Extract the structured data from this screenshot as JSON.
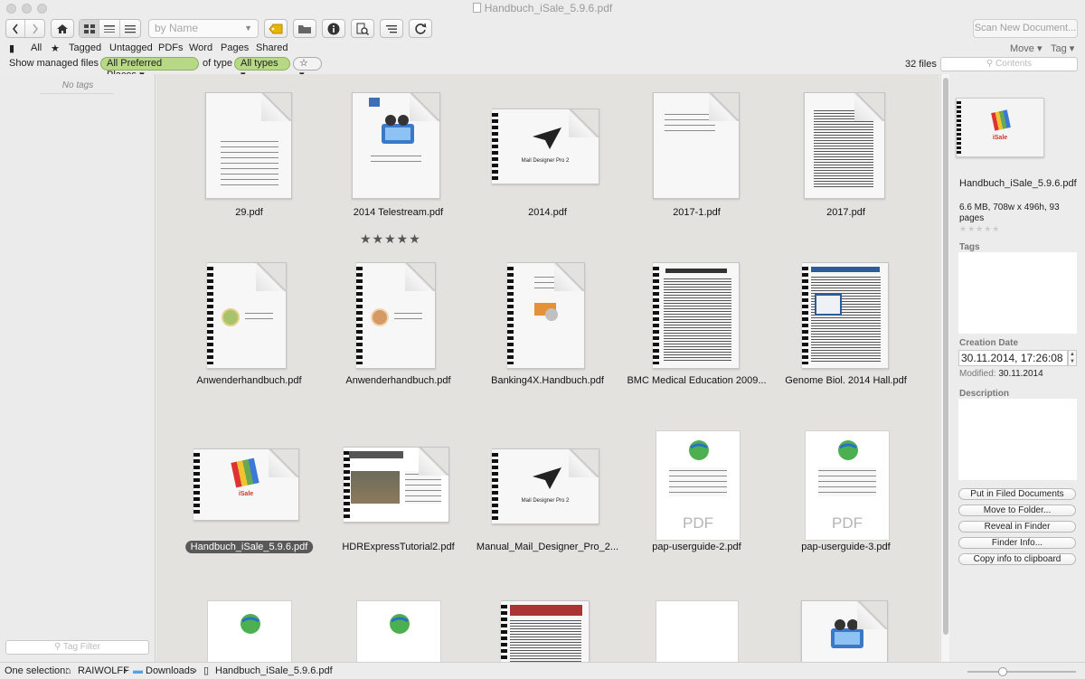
{
  "window": {
    "title": "Handbuch_iSale_5.9.6.pdf"
  },
  "toolbar": {
    "sort_placeholder": "by Name",
    "scan_button": "Scan New Document..."
  },
  "filters": {
    "all": "All",
    "tagged": "Tagged",
    "untagged": "Untagged",
    "pdfs": "PDFs",
    "word": "Word",
    "pages": "Pages",
    "shared": "Shared",
    "move": "Move ▾",
    "tag": "Tag ▾"
  },
  "options": {
    "show_label": "Show managed files in",
    "places": "All Preferred Places",
    "of_type": "of type",
    "types": "All types",
    "star_filter": "☆ ▾",
    "count": "32 files",
    "contents_placeholder": "Contents"
  },
  "sidebar": {
    "no_tags": "No tags",
    "tag_filter": "Tag Filter"
  },
  "files": [
    {
      "name": "29.pdf",
      "rating": ""
    },
    {
      "name": "2014 Telestream.pdf",
      "rating": "★★★★★"
    },
    {
      "name": "2014.pdf",
      "rating": ""
    },
    {
      "name": "2017-1.pdf",
      "rating": ""
    },
    {
      "name": "2017.pdf",
      "rating": ""
    },
    {
      "name": "Anwenderhandbuch.pdf",
      "rating": ""
    },
    {
      "name": "Anwenderhandbuch.pdf",
      "rating": ""
    },
    {
      "name": "Banking4X.Handbuch.pdf",
      "rating": ""
    },
    {
      "name": "BMC Medical Education 2009...",
      "rating": ""
    },
    {
      "name": "Genome Biol. 2014 Hall.pdf",
      "rating": ""
    },
    {
      "name": "Handbuch_iSale_5.9.6.pdf",
      "rating": "",
      "selected": true
    },
    {
      "name": "HDRExpressTutorial2.pdf",
      "rating": ""
    },
    {
      "name": "Manual_Mail_Designer_Pro_2...",
      "rating": ""
    },
    {
      "name": "pap-userguide-2.pdf",
      "rating": ""
    },
    {
      "name": "pap-userguide-3.pdf",
      "rating": ""
    }
  ],
  "thumb_text": {
    "mail_designer": "Mail Designer Pro 2",
    "pdf": "PDF",
    "isale": "iSale"
  },
  "inspector": {
    "name": "Handbuch_iSale_5.9.6.pdf",
    "size": "6.6 MB, 708w x 496h, 93 pages",
    "stars": "★★★★★",
    "tags_label": "Tags",
    "creation_label": "Creation Date",
    "creation_value": "30.11.2014, 17:26:08",
    "modified_label": "Modified:",
    "modified_value": "30.11.2014",
    "description_label": "Description",
    "buttons": [
      "Put in Filed Documents",
      "Move to Folder...",
      "Reveal in Finder",
      "Finder Info...",
      "Copy info to clipboard"
    ]
  },
  "status": {
    "selection": "One selection:",
    "crumb1": "RAIWOLFF",
    "crumb2": "Downloads",
    "crumb3": "Handbuch_iSale_5.9.6.pdf"
  },
  "colors": {
    "pill_green": "#b7d885",
    "grid_bg": "#e3e2de",
    "selected_caption": "#595959"
  }
}
